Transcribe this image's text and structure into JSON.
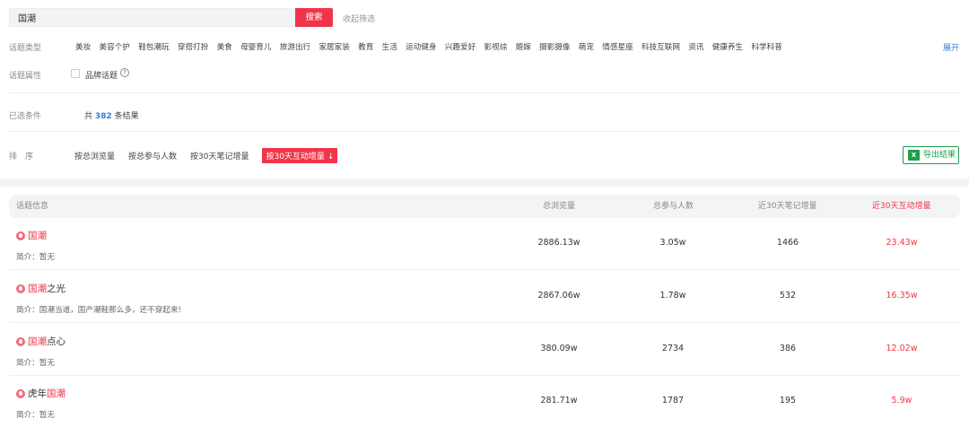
{
  "search": {
    "value": "国潮",
    "button_label": "搜索",
    "collapse_label": "收起筛选"
  },
  "filters": {
    "type_label": "话题类型",
    "categories": [
      "美妆",
      "美容个护",
      "鞋包潮玩",
      "穿搭打扮",
      "美食",
      "母婴育儿",
      "旅游出行",
      "家居家装",
      "教育",
      "生活",
      "运动健身",
      "兴趣爱好",
      "影视综",
      "婚嫁",
      "摄影摄像",
      "萌宠",
      "情感星座",
      "科技互联网",
      "资讯",
      "健康养生",
      "科学科普"
    ],
    "expand_label": "展开",
    "attr_label": "话题属性",
    "brand_label": "品牌话题",
    "help_icon": "?"
  },
  "selected": {
    "label": "已选条件",
    "prefix": "共",
    "count": "382",
    "suffix": "条结果"
  },
  "sort": {
    "label": "排　序",
    "options": [
      "按总浏览量",
      "按总参与人数",
      "按30天笔记增量"
    ],
    "active": "按30天互动增量",
    "active_arrow": "↓",
    "export_label": "导出结果",
    "export_icon": "X"
  },
  "table": {
    "headers": [
      "话题信息",
      "总浏览量",
      "总参与人数",
      "近30天笔记增量",
      "近30天互动增量"
    ],
    "rows": [
      {
        "prefix": "",
        "hl": "国潮",
        "suffix": "",
        "intro": "简介：暂无",
        "views": "2886.13w",
        "participants": "3.05w",
        "notes": "1466",
        "interactions": "23.43w"
      },
      {
        "prefix": "",
        "hl": "国潮",
        "suffix": "之光",
        "intro": "简介：国潮当道，国产潮鞋那么多，还不穿起来!",
        "views": "2867.06w",
        "participants": "1.78w",
        "notes": "532",
        "interactions": "16.35w"
      },
      {
        "prefix": "",
        "hl": "国潮",
        "suffix": "点心",
        "intro": "简介：暂无",
        "views": "380.09w",
        "participants": "2734",
        "notes": "386",
        "interactions": "12.02w"
      },
      {
        "prefix": "虎年",
        "hl": "国潮",
        "suffix": "",
        "intro": "简介：暂无",
        "views": "281.71w",
        "participants": "1787",
        "notes": "195",
        "interactions": "5.9w"
      }
    ]
  },
  "colors": {
    "accent": "#f0354a",
    "link": "#3a7bd5",
    "export": "#1f9e4a"
  }
}
